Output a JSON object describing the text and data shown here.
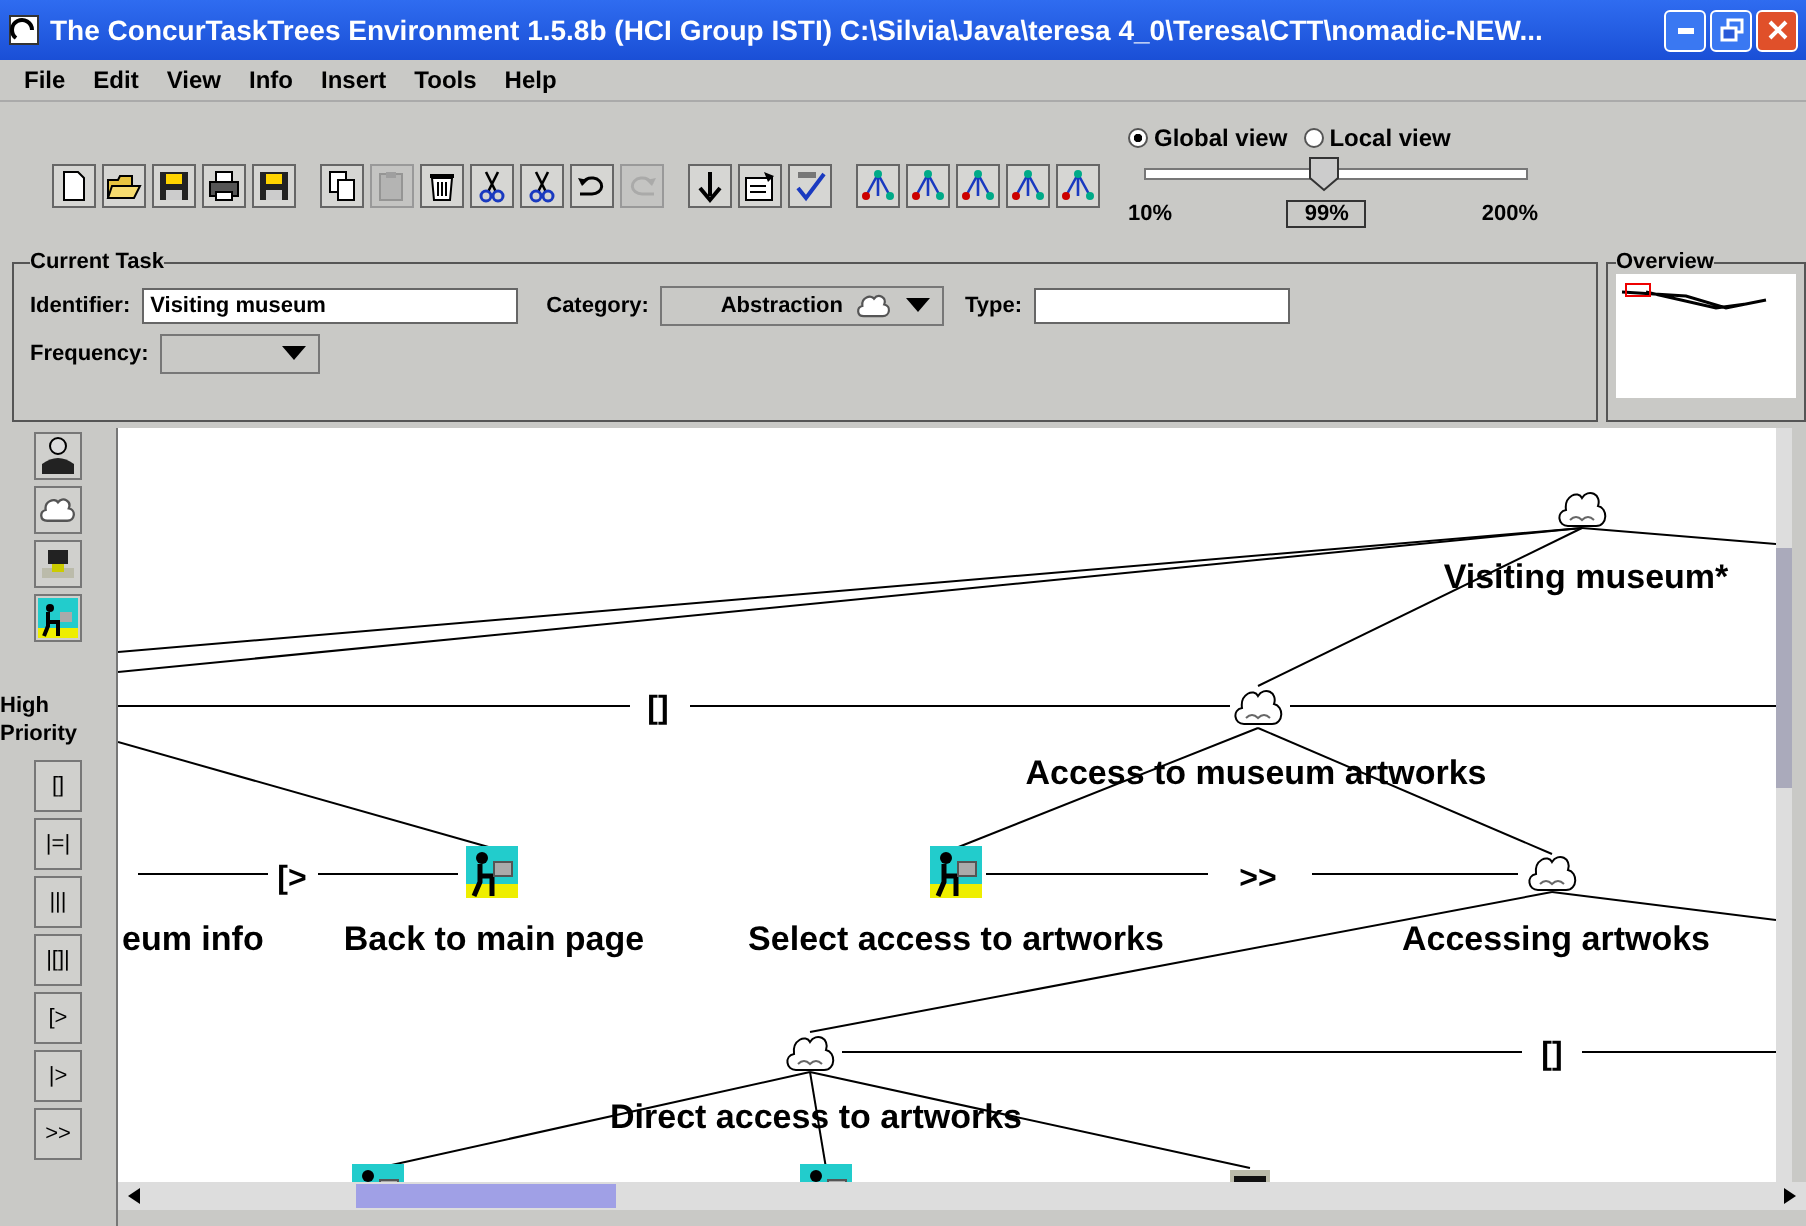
{
  "window": {
    "title": "The ConcurTaskTrees Environment 1.5.8b (HCI Group ISTI) C:\\Silvia\\Java\\teresa 4_0\\Teresa\\CTT\\nomadic-NEW..."
  },
  "menu": [
    "File",
    "Edit",
    "View",
    "Info",
    "Insert",
    "Tools",
    "Help"
  ],
  "toolbar": [
    [
      {
        "kind": "new",
        "disabled": false
      },
      {
        "kind": "open",
        "disabled": false
      },
      {
        "kind": "save",
        "disabled": false
      },
      {
        "kind": "print",
        "disabled": false
      },
      {
        "kind": "save",
        "disabled": false
      }
    ],
    [
      {
        "kind": "copy",
        "disabled": false
      },
      {
        "kind": "paste",
        "disabled": true
      },
      {
        "kind": "delete",
        "disabled": false
      },
      {
        "kind": "cut",
        "disabled": false
      },
      {
        "kind": "cut",
        "disabled": false
      },
      {
        "kind": "undo",
        "disabled": false
      },
      {
        "kind": "redo",
        "disabled": true
      }
    ],
    [
      {
        "kind": "down",
        "disabled": false
      },
      {
        "kind": "properties",
        "disabled": false
      },
      {
        "kind": "check",
        "disabled": false
      }
    ],
    [
      {
        "kind": "tree",
        "disabled": false
      },
      {
        "kind": "tree",
        "disabled": false
      },
      {
        "kind": "tree",
        "disabled": false
      },
      {
        "kind": "tree",
        "disabled": false
      },
      {
        "kind": "tree",
        "disabled": false
      }
    ]
  ],
  "view_options": [
    {
      "label": "Global view",
      "selected": true
    },
    {
      "label": "Local view",
      "selected": false
    }
  ],
  "zoom": {
    "level": 0.47,
    "min_label": "10%",
    "value": "99%",
    "max_label": "200%"
  },
  "current_task": {
    "title": "Current Task",
    "identifier_label": "Identifier:",
    "identifier": "Visiting museum",
    "category_label": "Category:",
    "category": "Abstraction",
    "type_label": "Type:",
    "frequency_label": "Frequency:"
  },
  "overview": {
    "title": "Overview"
  },
  "palette": {
    "task_types": [
      {
        "kind": "user"
      },
      {
        "kind": "abstraction"
      },
      {
        "kind": "application"
      },
      {
        "kind": "interaction"
      }
    ],
    "priority_label": "High Priority",
    "operators": [
      "[]",
      "|=|",
      "|||",
      "|[]|",
      "[>",
      "|>",
      ">>"
    ]
  },
  "canvas": {
    "nodes": [
      {
        "name": "Visiting museum*",
        "kind": "abstraction"
      },
      {
        "name": "Access to museum artworks",
        "kind": "abstraction"
      },
      {
        "name": "eum info"
      },
      {
        "name": "Back to main page",
        "kind": "interaction"
      },
      {
        "name": "Select access to artworks",
        "kind": "interaction"
      },
      {
        "name": "Accessing artwoks",
        "kind": "abstraction"
      },
      {
        "name": "Direct access to artworks",
        "kind": "abstraction"
      },
      {
        "kind": "interaction"
      },
      {
        "kind": "interaction"
      },
      {
        "kind": "application"
      }
    ],
    "operators": [
      "[]",
      "[>",
      ">>",
      "[]"
    ]
  }
}
